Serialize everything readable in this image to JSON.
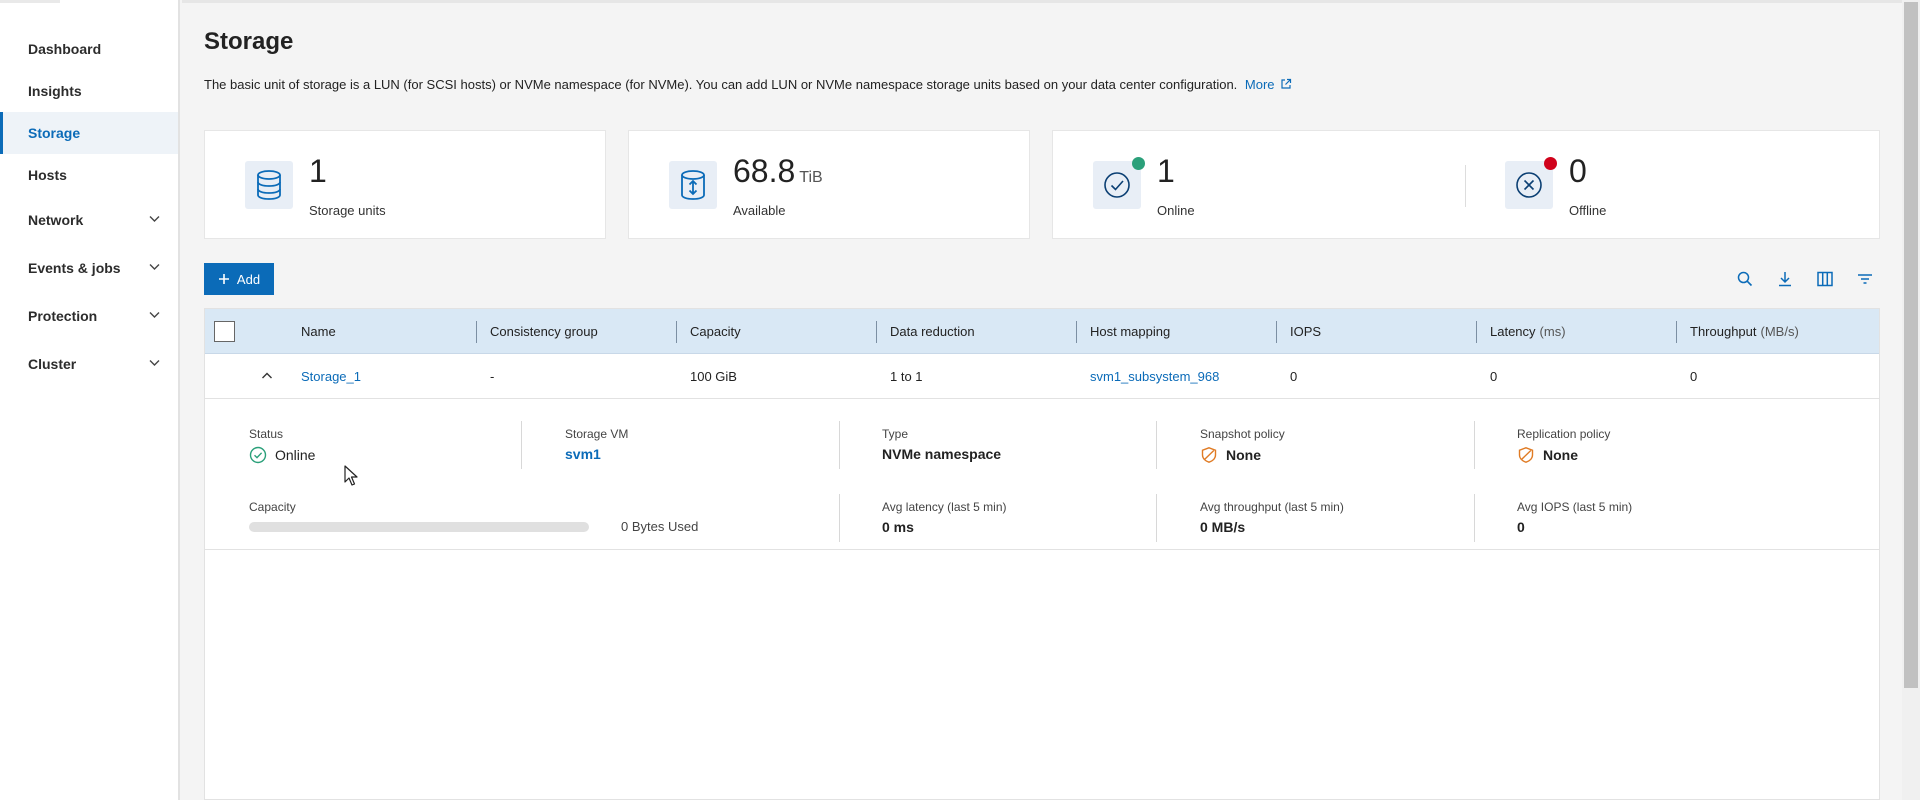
{
  "sidebar": {
    "items": [
      {
        "label": "Dashboard"
      },
      {
        "label": "Insights"
      },
      {
        "label": "Storage",
        "active": true
      },
      {
        "label": "Hosts"
      },
      {
        "label": "Network",
        "expandable": true
      },
      {
        "label": "Events & jobs",
        "expandable": true
      },
      {
        "label": "Protection",
        "expandable": true
      },
      {
        "label": "Cluster",
        "expandable": true
      }
    ]
  },
  "page": {
    "title": "Storage",
    "description": "The basic unit of storage is a LUN (for SCSI hosts) or NVMe namespace (for NVMe). You can add LUN or NVMe namespace storage units based on your data center configuration.",
    "more_link": "More"
  },
  "summary": {
    "storage_units": {
      "value": "1",
      "label": "Storage units",
      "icon": "database-icon"
    },
    "available": {
      "value": "68.8",
      "unit": "TiB",
      "label": "Available",
      "icon": "storage-capacity-icon"
    },
    "online": {
      "value": "1",
      "label": "Online",
      "icon": "check-circle-icon",
      "status_color": "#2ba07a"
    },
    "offline": {
      "value": "0",
      "label": "Offline",
      "icon": "x-circle-icon",
      "status_color": "#d0021b"
    }
  },
  "toolbar": {
    "add_label": "Add",
    "icons": [
      "search-icon",
      "download-icon",
      "columns-icon",
      "filter-icon"
    ]
  },
  "table": {
    "columns": [
      "Name",
      "Consistency group",
      "Capacity",
      "Data reduction",
      "Host mapping",
      "IOPS",
      "Latency",
      "Throughput"
    ],
    "column_units": {
      "latency": "(ms)",
      "throughput": "(MB/s)"
    },
    "rows": [
      {
        "name": "Storage_1",
        "consistency_group": "-",
        "capacity": "100 GiB",
        "data_reduction": "1 to 1",
        "host_mapping": "svm1_subsystem_968",
        "iops": "0",
        "latency": "0",
        "throughput": "0"
      }
    ]
  },
  "details": {
    "status_label": "Status",
    "status_value": "Online",
    "storage_vm_label": "Storage VM",
    "storage_vm_value": "svm1",
    "type_label": "Type",
    "type_value": "NVMe namespace",
    "snapshot_label": "Snapshot policy",
    "snapshot_value": "None",
    "replication_label": "Replication policy",
    "replication_value": "None",
    "capacity_label": "Capacity",
    "capacity_used_fraction": 0,
    "capacity_used_text": "0 Bytes Used",
    "avg_latency_label": "Avg latency (last 5 min)",
    "avg_latency_value": "0 ms",
    "avg_throughput_label": "Avg throughput (last 5 min)",
    "avg_throughput_value": "0 MB/s",
    "avg_iops_label": "Avg IOPS (last 5 min)",
    "avg_iops_value": "0"
  },
  "colors": {
    "accent": "#0b6bb8",
    "header_bg": "#d9e8f5",
    "online": "#2ba07a",
    "offline": "#d0021b",
    "policy_warning": "#e07b24"
  }
}
